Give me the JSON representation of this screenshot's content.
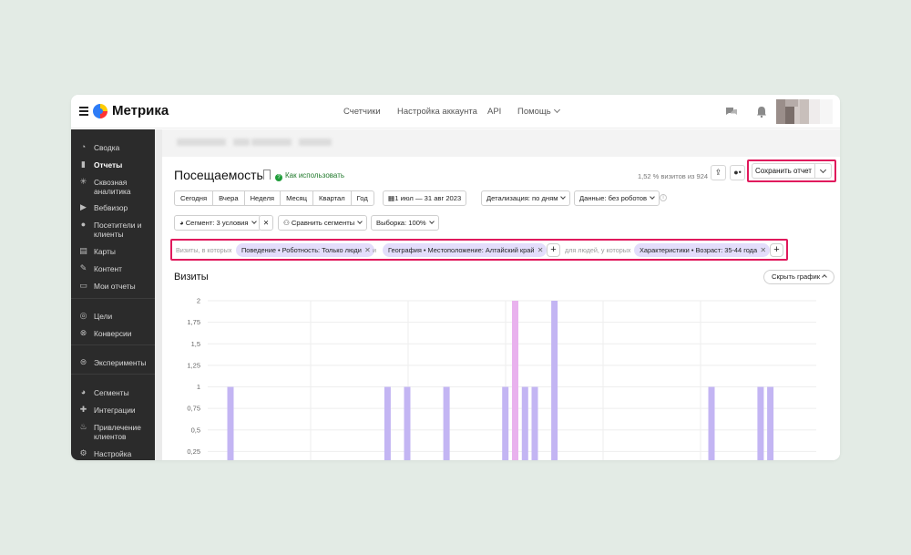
{
  "topbar": {
    "logo": "Метрика",
    "nav": [
      {
        "label": "Счетчики"
      },
      {
        "label": "Настройка аккаунта"
      },
      {
        "label": "API"
      },
      {
        "label": "Помощь"
      }
    ]
  },
  "sidebar": {
    "items": [
      {
        "label": "Сводка",
        "icon": "gauge-icon"
      },
      {
        "label": "Отчеты",
        "icon": "bar-chart-icon",
        "active": true
      },
      {
        "label": "Сквозная аналитика",
        "icon": "analytics-icon"
      },
      {
        "label": "Вебвизор",
        "icon": "play-icon"
      },
      {
        "label": "Посетители и клиенты",
        "icon": "user-icon"
      },
      {
        "label": "Карты",
        "icon": "map-icon"
      },
      {
        "label": "Контент",
        "icon": "pencil-icon"
      },
      {
        "label": "Мои отчеты",
        "icon": "inbox-icon"
      },
      {
        "label": "Цели",
        "icon": "target-icon"
      },
      {
        "label": "Конверсии",
        "icon": "conversion-icon"
      },
      {
        "label": "Эксперименты",
        "icon": "experiment-icon"
      },
      {
        "label": "Сегменты",
        "icon": "pie-icon"
      },
      {
        "label": "Интеграции",
        "icon": "puzzle-icon"
      },
      {
        "label": "Привлечение клиентов",
        "icon": "flame-icon"
      },
      {
        "label": "Настройка",
        "icon": "gear-icon"
      }
    ]
  },
  "report": {
    "title": "Посещаемость",
    "help_link": "Как использовать",
    "sample_info": "1,52 % визитов из 924",
    "save_label": "Сохранить отчет"
  },
  "period": {
    "buttons": [
      "Сегодня",
      "Вчера",
      "Неделя",
      "Месяц",
      "Квартал",
      "Год"
    ],
    "date_range": "1 июл — 31 авг 2023",
    "detail": "Детализация: по дням",
    "data": "Данные: без роботов"
  },
  "segment": {
    "label": "Сегмент: 3 условия",
    "compare": "Сравнить сегменты",
    "sample": "Выборка: 100%"
  },
  "filters": {
    "prefix": "Визиты, в которых",
    "chip1": "Поведение • Роботность: Только люди",
    "and": "и",
    "chip2": "География • Местоположение: Алтайский край",
    "people": "для людей, у которых",
    "chip3": "Характеристики • Возраст: 35-44 года"
  },
  "chart_section": {
    "title": "Визиты",
    "hide_label": "Скрыть график"
  },
  "chart_data": {
    "type": "bar",
    "title": "Визиты",
    "ylim": [
      0,
      2
    ],
    "yticks": [
      "2",
      "1,75",
      "1,5",
      "1,25",
      "1",
      "0,75",
      "0,5",
      "0,25"
    ],
    "x_days": 62,
    "series": [
      {
        "values": [
          {
            "day": 2,
            "value": 1
          },
          {
            "day": 18,
            "value": 1
          },
          {
            "day": 20,
            "value": 1
          },
          {
            "day": 24,
            "value": 1
          },
          {
            "day": 30,
            "value": 1
          },
          {
            "day": 31,
            "value": 2,
            "highlight": true
          },
          {
            "day": 32,
            "value": 1
          },
          {
            "day": 33,
            "value": 1
          },
          {
            "day": 35,
            "value": 2
          },
          {
            "day": 51,
            "value": 1
          },
          {
            "day": 56,
            "value": 1
          },
          {
            "day": 57,
            "value": 1
          }
        ]
      }
    ],
    "colors": {
      "bar": "#c3b5f3",
      "highlight": "#e9b2ee",
      "grid": "#eeeeee"
    }
  }
}
